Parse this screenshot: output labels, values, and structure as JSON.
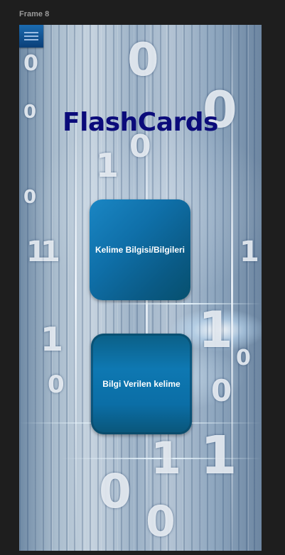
{
  "canvas": {
    "frame_label": "Frame 8"
  },
  "screen": {
    "title": "FlashCards",
    "menu_icon": "hamburger-menu-icon",
    "buttons": {
      "word_info_label": "Kelime Bilgisi/Bilgileri",
      "info_given_word_label": "Bilgi Verilen kelime"
    },
    "colors": {
      "title": "#0b0b7a",
      "button_primary": "#0f6fa8",
      "menu_button": "#1b6bb0"
    }
  }
}
